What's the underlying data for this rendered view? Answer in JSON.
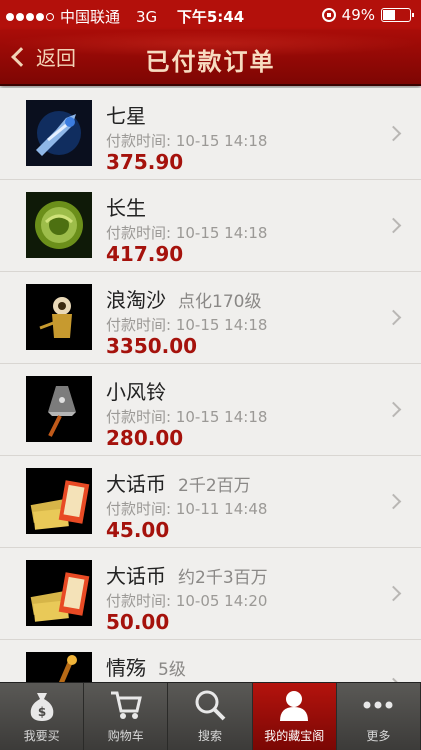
{
  "status_bar": {
    "carrier": "中国联通",
    "network": "3G",
    "time": "下午5:44",
    "battery": "49%",
    "battery_level": 0.49
  },
  "nav": {
    "back_label": "返回",
    "title": "已付款订单"
  },
  "orders": [
    {
      "name": "七星",
      "sub": "",
      "paid_label": "付款时间: 10-15 14:18",
      "price": "375.90",
      "icon": "weapon-blue-icon"
    },
    {
      "name": "长生",
      "sub": "",
      "paid_label": "付款时间: 10-15 14:18",
      "price": "417.90",
      "icon": "jade-ring-icon"
    },
    {
      "name": "浪淘沙",
      "sub": "点化170级",
      "paid_label": "付款时间: 10-15 14:18",
      "price": "3350.00",
      "icon": "character-icon"
    },
    {
      "name": "小风铃",
      "sub": "",
      "paid_label": "付款时间: 10-15 14:18",
      "price": "280.00",
      "icon": "bell-item-icon"
    },
    {
      "name": "大话币",
      "sub": "2千2百万",
      "paid_label": "付款时间: 10-11 14:48",
      "price": "45.00",
      "icon": "coin-notes-icon"
    },
    {
      "name": "大话币",
      "sub": "约2千3百万",
      "paid_label": "付款时间: 10-05 14:20",
      "price": "50.00",
      "icon": "coin-notes-icon"
    },
    {
      "name": "情殇",
      "sub": "5级",
      "paid_label": "",
      "price": "",
      "icon": "staff-icon"
    }
  ],
  "tabs": [
    {
      "label": "我要买",
      "icon": "money-bag-icon",
      "active": false
    },
    {
      "label": "购物车",
      "icon": "cart-icon",
      "active": false
    },
    {
      "label": "搜索",
      "icon": "search-icon",
      "active": false
    },
    {
      "label": "我的藏宝阁",
      "icon": "user-icon",
      "active": true
    },
    {
      "label": "更多",
      "icon": "more-icon",
      "active": false
    }
  ],
  "colors": {
    "brand_red": "#a90c08",
    "price_red": "#a5120c",
    "tab_bg": "#4a4947"
  }
}
